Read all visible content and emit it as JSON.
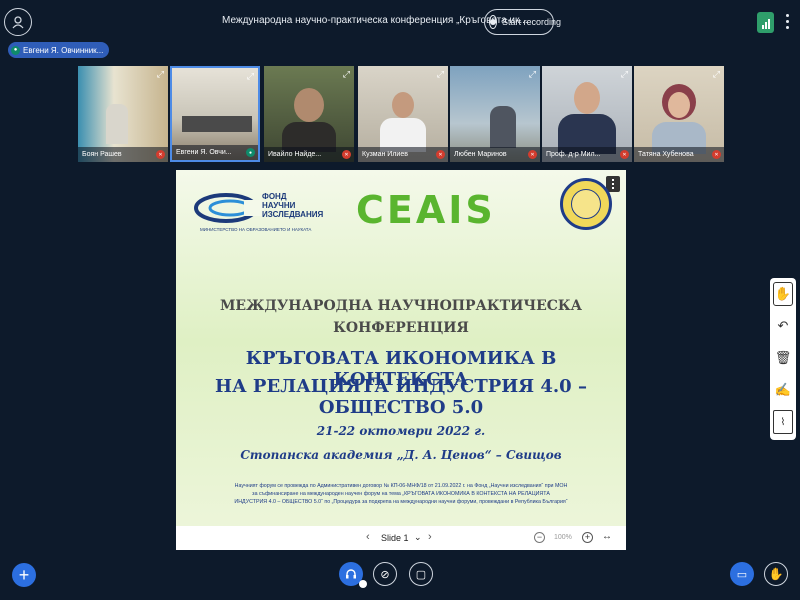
{
  "header": {
    "title": "Международна научно-практическа конференция „Кръговата ик...",
    "record_label": "Start recording"
  },
  "presenter": {
    "name": "Евгени Я. Овчинник..."
  },
  "participants": [
    {
      "name": "Боян Рашев",
      "muted": true,
      "bg": "#8aa6b6"
    },
    {
      "name": "Евгени Я. Овчи...",
      "muted": false,
      "active": true,
      "bg": "#9aa9a0"
    },
    {
      "name": "Ивайло Найде...",
      "muted": true,
      "bg": "#5b6a4c"
    },
    {
      "name": "Кузман Илиев",
      "muted": true,
      "bg": "#b8b2a6"
    },
    {
      "name": "Любен Маринов",
      "muted": true,
      "bg": "#6a8ca8"
    },
    {
      "name": "Проф. д-р Мил...",
      "muted": true,
      "bg": "#4d5a72"
    },
    {
      "name": "Татяна Хубенова",
      "muted": true,
      "bg": "#c9c0b0"
    }
  ],
  "slide": {
    "fni_title_line1": "ФОНД",
    "fni_title_line2": "НАУЧНИ",
    "fni_title_line3": "ИЗСЛЕДВАНИЯ",
    "fni_subtitle": "МИНИСТЕРСТВО НА ОБРАЗОВАНИЕТО И НАУКАТА",
    "ceais": "CEAIS",
    "conf_line1": "МЕЖДУНАРОДНА НАУЧНОПРАКТИЧЕСКА",
    "conf_line2": "КОНФЕРЕНЦИЯ",
    "main_line1": "КРЪГОВАТА ИКОНОМИКА В КОНТЕКСТА",
    "main_line2": "НА РЕЛАЦИЯТА ИНДУСТРИЯ 4.0 – ОБЩЕСТВО 5.0",
    "date": "21-22 октомври 2022 г.",
    "place": "Стопанска академия „Д. А. Ценов“ – Свищов",
    "note_line1": "Научният форум се провежда по Административен договор № КП-06-МНФ/18 от 21.09.2022 г. на Фонд „Научни изследвания“ при МОН",
    "note_line2": "за съфинансиране на международен научен форум на тема „КРЪГОВАТА ИКОНОМИКА В КОНТЕКСТА НА РЕЛАЦИЯТА",
    "note_line3": "ИНДУСТРИЯ 4.0 – ОБЩЕСТВО 5.0“ по „Процедура за подкрепа на международни научни форуми, провеждани в Република България“"
  },
  "slide_controls": {
    "slide_label": "Slide 1",
    "zoom": "100%"
  }
}
